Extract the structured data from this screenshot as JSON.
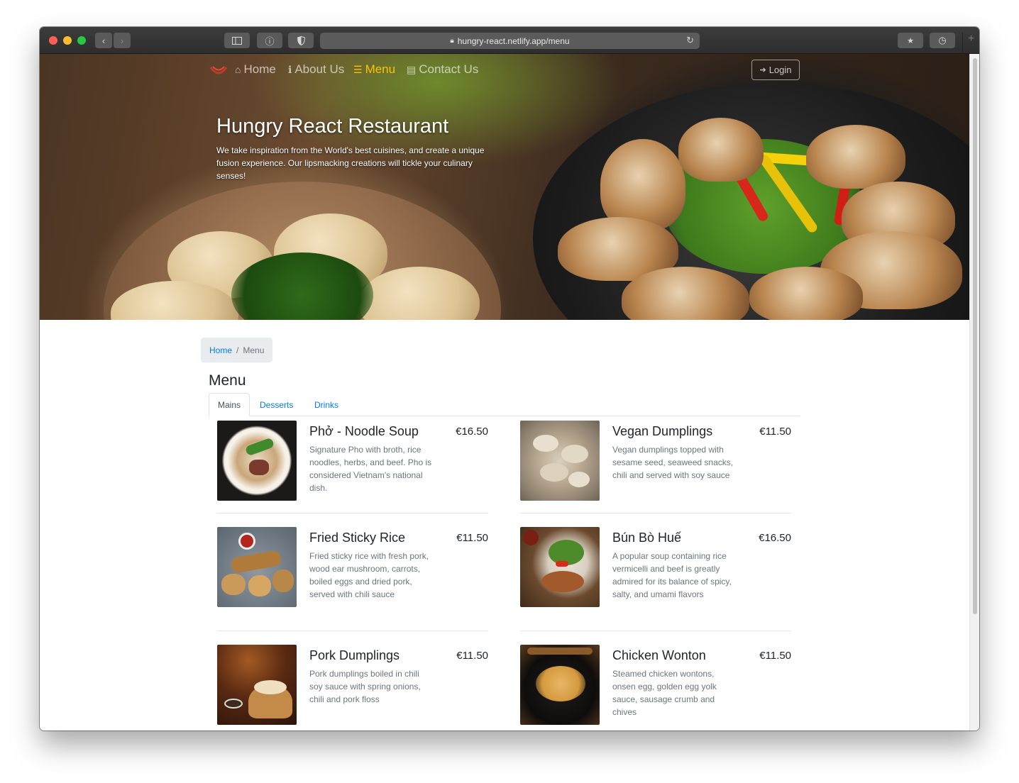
{
  "browser": {
    "url": "hungry-react.netlify.app/menu"
  },
  "nav": {
    "items": [
      {
        "label": "Home",
        "icon": "home-icon"
      },
      {
        "label": "About Us",
        "icon": "info-icon"
      },
      {
        "label": "Menu",
        "icon": "list-icon",
        "active": true
      },
      {
        "label": "Contact Us",
        "icon": "address-card-icon"
      }
    ],
    "login_label": "Login"
  },
  "hero": {
    "title": "Hungry React Restaurant",
    "text": "We take inspiration from the World's best cuisines, and create a unique fusion experience. Our lipsmacking creations will tickle your culinary senses!"
  },
  "breadcrumb": {
    "home": "Home",
    "separator": "/",
    "current": "Menu"
  },
  "menu": {
    "heading": "Menu",
    "tabs": [
      {
        "label": "Mains",
        "active": true
      },
      {
        "label": "Desserts"
      },
      {
        "label": "Drinks"
      }
    ],
    "items": [
      {
        "name": "Phở - Noodle Soup",
        "price": "€16.50",
        "desc": "Signature Pho with broth, rice noodles, herbs, and beef. Pho is considered Vietnam's national dish."
      },
      {
        "name": "Vegan Dumplings",
        "price": "€11.50",
        "desc": "Vegan dumplings topped with sesame seed, seaweed snacks, chili and served with soy sauce"
      },
      {
        "name": "Fried Sticky Rice",
        "price": "€11.50",
        "desc": "Fried sticky rice with fresh pork, wood ear mushroom, carrots, boiled eggs and dried pork, served with chili sauce"
      },
      {
        "name": "Bún Bò Huế",
        "price": "€16.50",
        "desc": "A popular soup containing rice vermicelli and beef is greatly admired for its balance of spicy, salty, and umami flavors"
      },
      {
        "name": "Pork Dumplings",
        "price": "€11.50",
        "desc": "Pork dumplings boiled in chili soy sauce with spring onions, chili and pork floss"
      },
      {
        "name": "Chicken Wonton",
        "price": "€11.50",
        "desc": "Steamed chicken wontons, onsen egg, golden egg yolk sauce, sausage crumb and chives"
      }
    ]
  },
  "colors": {
    "link": "#007bff",
    "active_nav": "#ffc107",
    "text": "#212529",
    "muted": "#6c757d",
    "breadcrumb_bg": "#e9ecef"
  }
}
